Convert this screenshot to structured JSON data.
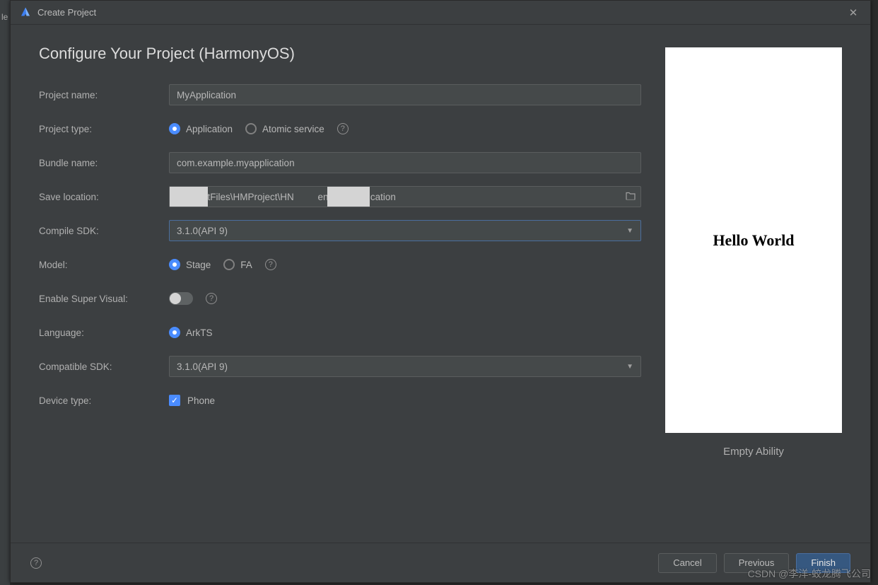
{
  "dialog": {
    "title": "Create Project",
    "heading": "Configure Your Project (HarmonyOS)"
  },
  "form": {
    "project_name": {
      "label": "Project name:",
      "value": "MyApplication"
    },
    "project_type": {
      "label": "Project type:",
      "options": [
        "Application",
        "Atomic service"
      ],
      "selected": "Application"
    },
    "bundle_name": {
      "label": "Bundle name:",
      "value": "com.example.myapplication"
    },
    "save_location": {
      "label": "Save location:",
      "value": "       jectFiles\\HMProject\\HN         eng\\MyApplication"
    },
    "compile_sdk": {
      "label": "Compile SDK:",
      "value": "3.1.0(API 9)"
    },
    "model": {
      "label": "Model:",
      "options": [
        "Stage",
        "FA"
      ],
      "selected": "Stage"
    },
    "enable_super_visual": {
      "label": "Enable Super Visual:",
      "enabled": false
    },
    "language": {
      "label": "Language:",
      "options": [
        "ArkTS"
      ],
      "selected": "ArkTS"
    },
    "compatible_sdk": {
      "label": "Compatible SDK:",
      "value": "3.1.0(API 9)"
    },
    "device_type": {
      "label": "Device type:",
      "option": "Phone",
      "checked": true
    }
  },
  "preview": {
    "text": "Hello World",
    "caption": "Empty Ability"
  },
  "footer": {
    "cancel": "Cancel",
    "previous": "Previous",
    "finish": "Finish"
  },
  "watermark": "CSDN @李洋-蛟龙腾飞公司",
  "side_letter": "le"
}
